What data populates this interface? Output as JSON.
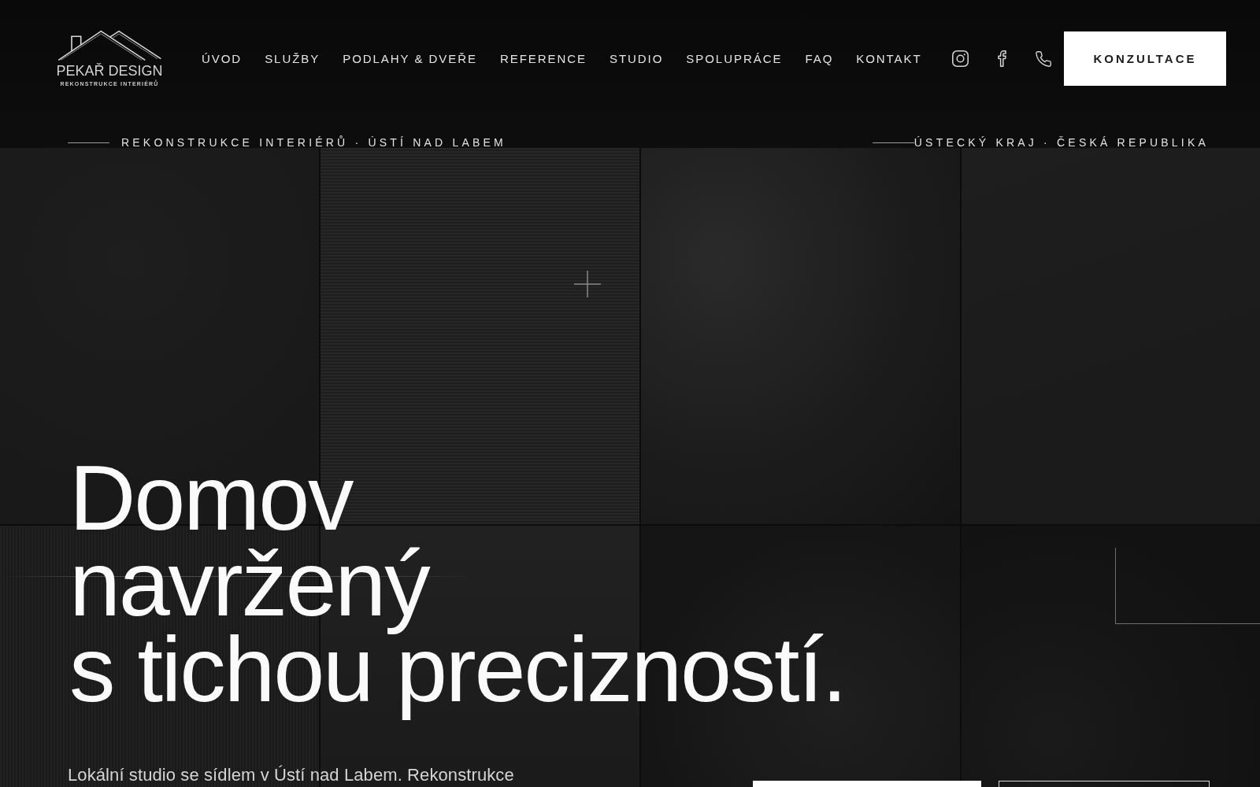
{
  "header": {
    "logo": {
      "name": "PEKAŘ DESIGN",
      "tagline": "REKONSTRUKCE INTERIÉRŮ"
    },
    "nav": [
      {
        "label": "ÚVOD"
      },
      {
        "label": "SLUŽBY"
      },
      {
        "label": "PODLAHY & DVEŘE"
      },
      {
        "label": "REFERENCE"
      },
      {
        "label": "STUDIO"
      },
      {
        "label": "SPOLUPRÁCE"
      },
      {
        "label": "FAQ"
      },
      {
        "label": "KONTAKT"
      }
    ],
    "social_links": [
      {
        "kind": "instagram"
      },
      {
        "kind": "facebook"
      },
      {
        "kind": "phone"
      }
    ],
    "cta_button": "KONZULTACE"
  },
  "eyebrow": {
    "left": "REKONSTRUKCE INTERIÉRŮ · ÚSTÍ NAD LABEM",
    "right": "ÚSTECKÝ KRAJ · ČESKÁ REPUBLIKA"
  },
  "hero": {
    "headline": [
      "Domov",
      "navržený",
      "s tichou precizností."
    ],
    "intro": "Lokální studio se sídlem v Ústí nad Labem. Rekonstrukce",
    "buttons": [
      {
        "kind": "solid"
      },
      {
        "kind": "outline"
      }
    ]
  }
}
